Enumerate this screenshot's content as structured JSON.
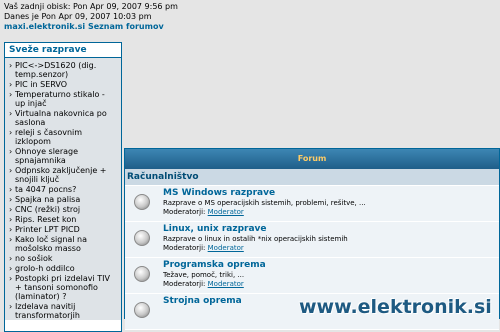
{
  "header": {
    "last_visit": "Vaš zadnji obisk: Pon Apr 09, 2007 9:56 pm",
    "now": "Danes je Pon Apr 09, 2007 10:03 pm",
    "site_link": "maxi.elektronik.si",
    "forum_index_link": "Seznam forumov"
  },
  "sidebar": {
    "title": "Sveže razprave",
    "items": [
      "PIC<->DS1620 (dig. temp.senzor)",
      "PIC in SERVO",
      "Temperaturno stikalo - up injač",
      "Virtualna nakovnica po saslona",
      "releji s časovnim izklopom",
      "Ohnoye slerage spnajamnika",
      "Odpnsko zaključenje + snojili ključ",
      "ta 4047 pocns?",
      "Spajka na palisa",
      "CNC (režki) stroj",
      "Rips. Reset kon",
      "Printer LPT PICD",
      "Kako loč signal na mošolsko masso",
      "no sošiok",
      "grolo-h oddilco",
      "Postopki pri izdelavi TIV + tansoni somonofio (laminator) ?",
      "Izdelava navitij transformatorjih"
    ]
  },
  "forum": {
    "header": "Forum",
    "category": "Računalništvo",
    "rows": [
      {
        "title": "MS Windows razprave",
        "desc": "Razprave o MS operacijskih sistemih, problemi, rešitve, ...",
        "moderators_label": "Moderatorji:",
        "moderators": "Moderator"
      },
      {
        "title": "Linux, unix razprave",
        "desc": "Razprave o linux in ostalih *nix operacijskih sistemih",
        "moderators_label": "Moderatorji:",
        "moderators": "Moderator"
      },
      {
        "title": "Programska oprema",
        "desc": "Težave, pomoč, triki, ...",
        "moderators_label": "Moderatorji:",
        "moderators": "Moderator"
      },
      {
        "title": "Strojna oprema",
        "desc": "",
        "moderators_label": "",
        "moderators": ""
      }
    ]
  },
  "watermark": "www.elektronik.si",
  "colors": {
    "accent": "#006699",
    "header_text": "#ffcc66",
    "category_bg": "#cbd9e4",
    "row_bg": "#eef3f7",
    "sidebar_bg": "#dee3e7"
  }
}
